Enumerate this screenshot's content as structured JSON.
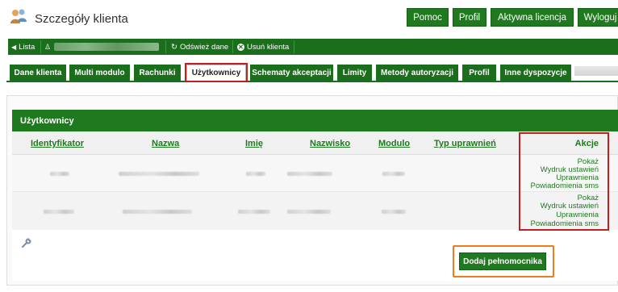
{
  "header": {
    "title": "Szczegóły klienta",
    "buttons": {
      "help": "Pomoc",
      "profile": "Profil",
      "license": "Aktywna licencja",
      "logout": "Wyloguj"
    }
  },
  "toolbar": {
    "back_label": "Lista",
    "refresh_label": "Odśwież dane",
    "delete_label": "Usuń klienta"
  },
  "tabs": [
    {
      "label": "Dane klienta"
    },
    {
      "label": "Multi modulo"
    },
    {
      "label": "Rachunki"
    },
    {
      "label": "Użytkownicy",
      "active": true
    },
    {
      "label": "Schematy akceptacji"
    },
    {
      "label": "Limity"
    },
    {
      "label": "Metody autoryzacji"
    },
    {
      "label": "Profil"
    },
    {
      "label": "Inne dyspozycje"
    }
  ],
  "users_panel": {
    "title": "Użytkownicy",
    "columns": [
      "Identyfikator",
      "Nazwa",
      "Imię",
      "Nazwisko",
      "Modulo",
      "Typ uprawnień",
      "Akcje"
    ],
    "actions": [
      "Pokaż",
      "Wydruk ustawień",
      "Uprawnienia",
      "Powiadomienia sms"
    ],
    "add_button": "Dodaj pełnomocnika"
  },
  "colors": {
    "brand_green": "#1f7a1f",
    "highlight_red": "#c41e1e",
    "highlight_orange": "#f07d1a"
  }
}
